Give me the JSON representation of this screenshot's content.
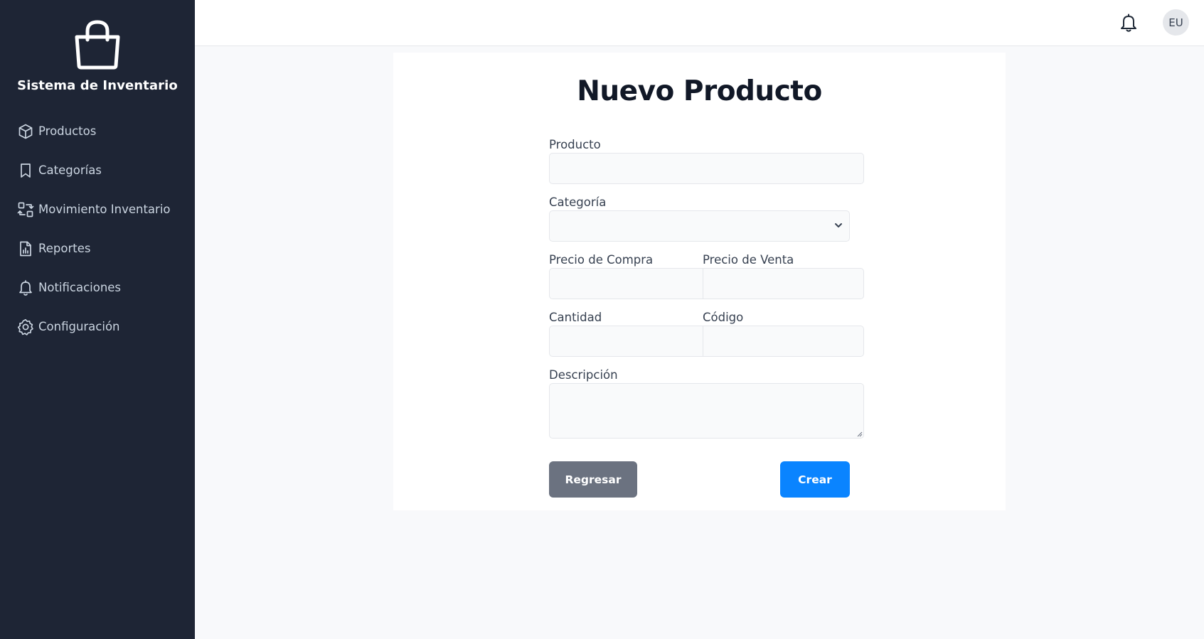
{
  "sidebar": {
    "brand_title": "Sistema de Inventario",
    "items": [
      {
        "label": "Productos",
        "icon": "box-icon"
      },
      {
        "label": "Categorías",
        "icon": "bookmark-icon"
      },
      {
        "label": "Movimiento Inventario",
        "icon": "swap-icon"
      },
      {
        "label": "Reportes",
        "icon": "report-icon"
      },
      {
        "label": "Notificaciones",
        "icon": "bell-icon"
      },
      {
        "label": "Configuración",
        "icon": "gear-icon"
      }
    ]
  },
  "topbar": {
    "avatar_initials": "EU"
  },
  "form": {
    "title": "Nuevo Producto",
    "producto_label": "Producto",
    "producto_value": "",
    "categoria_label": "Categoría",
    "categoria_value": "",
    "precio_compra_label": "Precio de Compra",
    "precio_compra_value": "",
    "precio_venta_label": "Precio de Venta",
    "precio_venta_value": "",
    "cantidad_label": "Cantidad",
    "cantidad_value": "",
    "codigo_label": "Código",
    "codigo_value": "",
    "descripcion_label": "Descripción",
    "descripcion_value": "",
    "back_label": "Regresar",
    "create_label": "Crear"
  },
  "colors": {
    "sidebar_bg": "#1e2535",
    "primary": "#0a84ff",
    "secondary": "#6b7280"
  }
}
